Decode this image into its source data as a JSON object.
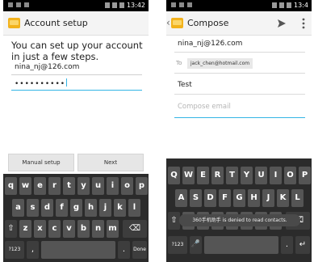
{
  "left_screen": {
    "status_time": "13:42",
    "title": "Account setup",
    "message": "You can set up your account in just a few steps.",
    "email_value": "nina_nj@126.com",
    "password_value": "••••••••••",
    "manual_setup_label": "Manual setup",
    "next_label": "Next",
    "keyboard": {
      "row1": [
        "q",
        "w",
        "e",
        "r",
        "t",
        "y",
        "u",
        "i",
        "o",
        "p"
      ],
      "row2": [
        "a",
        "s",
        "d",
        "f",
        "g",
        "h",
        "j",
        "k",
        "l"
      ],
      "row3": [
        "⇧",
        "z",
        "x",
        "c",
        "v",
        "b",
        "n",
        "m",
        "⌫"
      ],
      "row4": [
        "?123",
        ",",
        "",
        ".",
        "Done"
      ]
    }
  },
  "right_screen": {
    "status_time": "13:4",
    "back_glyph": "‹",
    "title": "Compose",
    "send_icon": "send-icon",
    "overflow_icon": "overflow-menu-icon",
    "from_value": "nina_nj@126.com",
    "to_label": "To",
    "to_chip": "jack_chen@hotmail.com",
    "subject_value": "Test",
    "body_placeholder": "Compose email",
    "toast_text": "360手机助手 is denied to read contacts.",
    "keyboard": {
      "row1": [
        "Q",
        "W",
        "E",
        "R",
        "T",
        "Y",
        "U",
        "I",
        "O",
        "P"
      ],
      "row2": [
        "A",
        "S",
        "D",
        "F",
        "G",
        "H",
        "J",
        "K",
        "L"
      ],
      "row3": [
        "⇧",
        "Z",
        "X",
        "C",
        "V",
        "B",
        "N",
        "M",
        "⌫"
      ],
      "row4": [
        "?123",
        "🎤",
        "",
        ".",
        "↵"
      ]
    }
  },
  "colors": {
    "accent": "#33b5e5",
    "keyboard_bg": "#2b2b2b",
    "key_bg": "#555555",
    "app_icon": "#f2b21c"
  }
}
